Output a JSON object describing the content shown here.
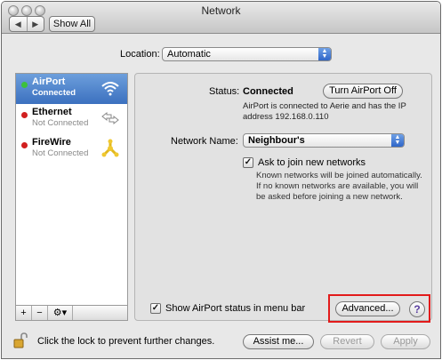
{
  "window": {
    "title": "Network"
  },
  "toolbar": {
    "back_glyph": "◀",
    "forward_glyph": "▶",
    "show_all_label": "Show All"
  },
  "location": {
    "label": "Location:",
    "value": "Automatic"
  },
  "services": [
    {
      "name": "AirPort",
      "status": "Connected",
      "dot_color": "#3cc13c",
      "icon": "wifi-icon",
      "selected": true
    },
    {
      "name": "Ethernet",
      "status": "Not Connected",
      "dot_color": "#d11f1f",
      "icon": "ethernet-arrows-icon",
      "selected": false
    },
    {
      "name": "FireWire",
      "status": "Not Connected",
      "dot_color": "#d11f1f",
      "icon": "firewire-icon",
      "selected": false
    }
  ],
  "sidebar_tools": {
    "add": "+",
    "remove": "−",
    "action": "⚙▾"
  },
  "detail": {
    "status_label": "Status:",
    "status_value": "Connected",
    "turn_off_label": "Turn AirPort Off",
    "status_desc_line1": "AirPort is connected to Aerie and has the IP",
    "status_desc_line2": "address 192.168.0.110",
    "network_name_label": "Network Name:",
    "network_name_value": "Neighbour's",
    "ask_join_label": "Ask to join new networks",
    "ask_join_checked": true,
    "ask_join_desc_line1": "Known networks will be joined automatically.",
    "ask_join_desc_line2": "If no known networks are available, you will",
    "ask_join_desc_line3": "be asked before joining a new network.",
    "menu_bar_label": "Show AirPort status in menu bar",
    "menu_bar_checked": true,
    "advanced_label": "Advanced...",
    "help_glyph": "?"
  },
  "footer": {
    "lock_text": "Click the lock to prevent further changes.",
    "assist_label": "Assist me...",
    "revert_label": "Revert",
    "apply_label": "Apply"
  },
  "colors": {
    "highlight": "#e21b1b",
    "selection": "#3b70bf",
    "popup_arrows": "#2f66c8"
  }
}
